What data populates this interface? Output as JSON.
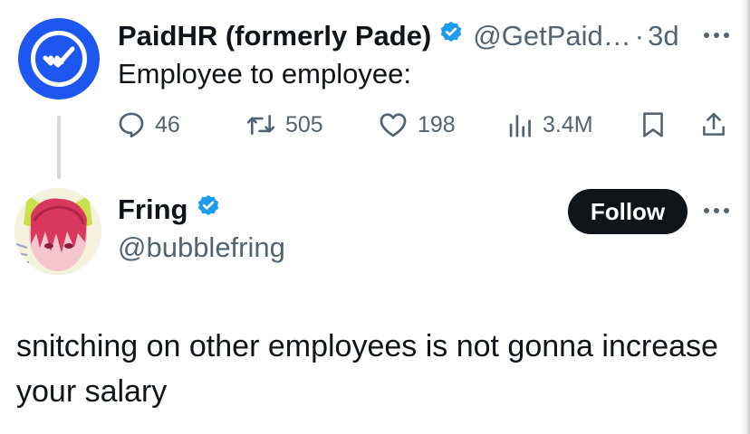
{
  "post1": {
    "author_name": "PaidHR (formerly Pade)",
    "handle": "@GetPaid…",
    "separator": "·",
    "time": "3d",
    "text": "Employee to employee:",
    "actions": {
      "replies": "46",
      "reposts": "505",
      "likes": "198",
      "views": "3.4M"
    }
  },
  "post2": {
    "author_name": "Fring",
    "handle": "@bubblefring",
    "follow_label": "Follow",
    "text": "snitching on other employees is not gonna increase your salary"
  },
  "colors": {
    "text_primary": "#0f1419",
    "text_secondary": "#536471",
    "verified_blue": "#1d9bf0",
    "brand_blue": "#1d57f0",
    "follow_button": "#0f1419"
  },
  "icons": {
    "paidhr_logo": "checkmark-logo-icon",
    "verified": "verified-badge-icon",
    "more": "more-dots-icon",
    "reply": "reply-bubble-icon",
    "repost": "repost-arrows-icon",
    "like": "heart-icon",
    "views": "bar-chart-icon",
    "bookmark": "bookmark-icon",
    "share": "share-upload-icon"
  }
}
